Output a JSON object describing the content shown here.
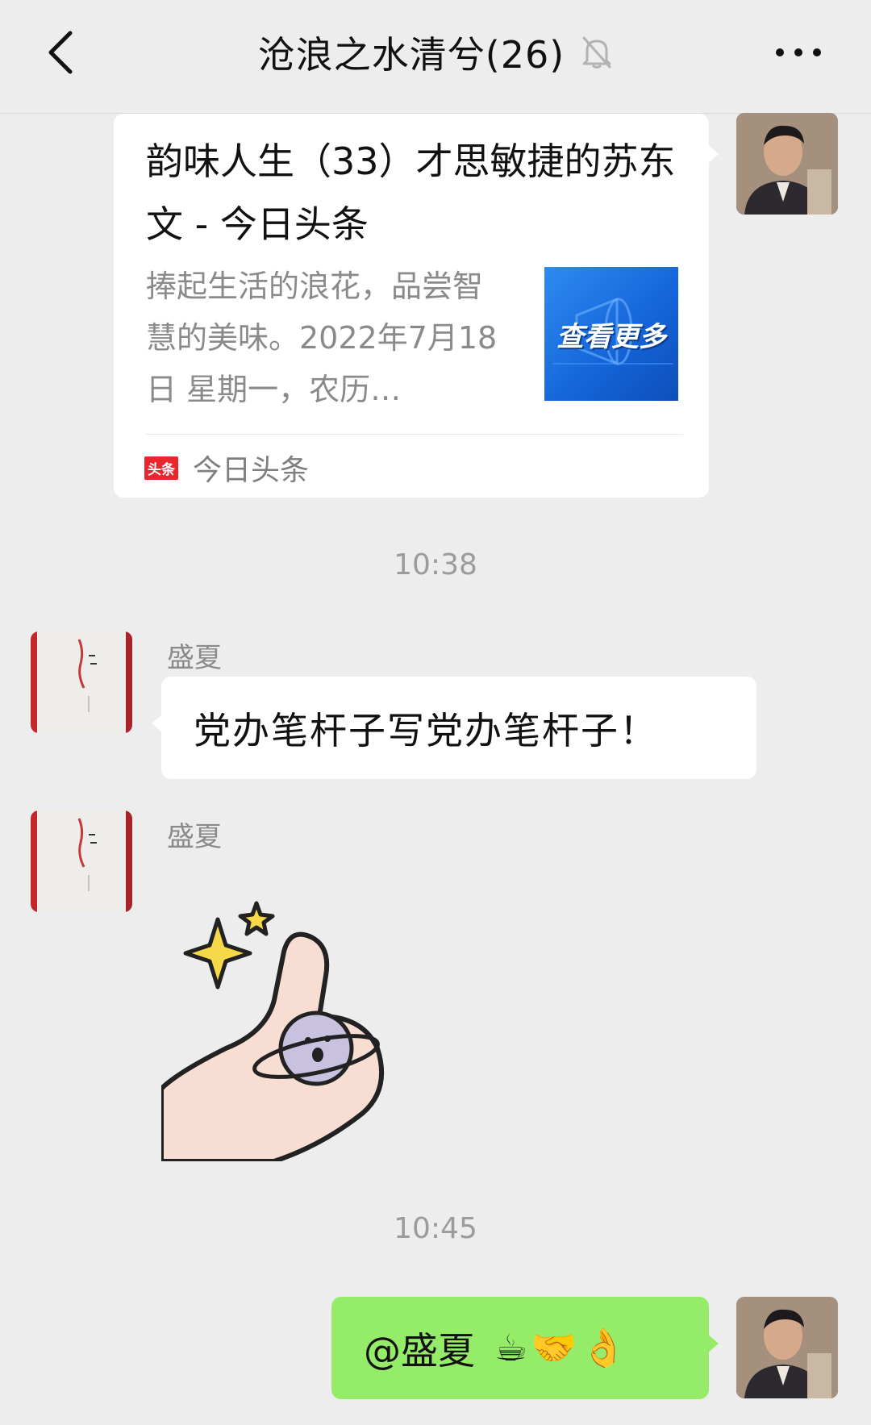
{
  "header": {
    "title": "沧浪之水清兮(26)",
    "back_icon": "chevron-left-icon",
    "mute_icon": "bell-off-icon",
    "more_icon": "ellipsis-icon"
  },
  "messages": {
    "link_card": {
      "title": "韵味人生（33）才思敏捷的苏东文 - 今日头条",
      "description": "捧起生活的浪花，品尝智慧的美味。2022年7月18日 星期一，农历…",
      "thumb_text": "查看更多",
      "source_badge": "头条",
      "source_name": "今日头条"
    },
    "time_1": "10:38",
    "msg_1": {
      "sender": "盛夏",
      "text": "党办笔杆子写党办笔杆子！"
    },
    "msg_2": {
      "sender": "盛夏",
      "sticker": "thumbs-up-planet-sticker"
    },
    "time_2": "10:45",
    "msg_3": {
      "text": "@盛夏",
      "emoji": "☕🤝👌"
    }
  },
  "colors": {
    "background": "#ededed",
    "bubble_self": "#95ec69",
    "bubble_other": "#ffffff",
    "source_badge": "#e8262e"
  }
}
